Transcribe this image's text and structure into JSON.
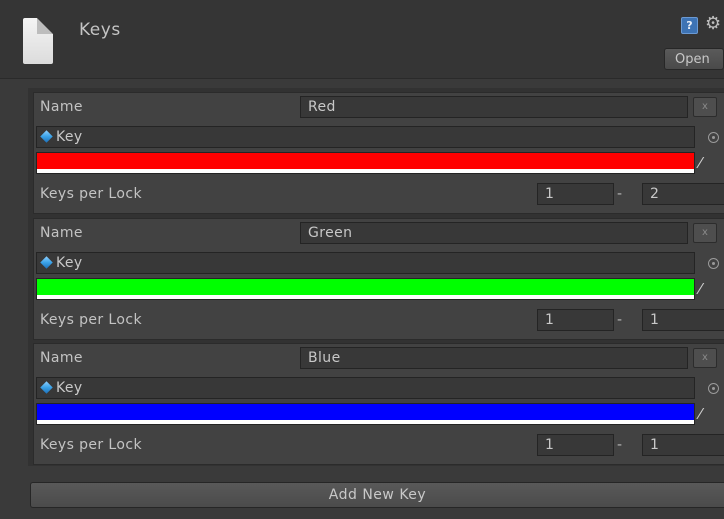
{
  "header": {
    "title": "Keys",
    "open_label": "Open",
    "help_icon": "help-icon",
    "gear_icon": "gear-icon"
  },
  "keys": [
    {
      "name_label": "Name",
      "name_value": "Red",
      "remove_label": "x",
      "object_label": "Key",
      "color": "#ff0000",
      "keys_per_lock_label": "Keys per Lock",
      "min": "1",
      "dash": "-",
      "max": "2"
    },
    {
      "name_label": "Name",
      "name_value": "Green",
      "remove_label": "x",
      "object_label": "Key",
      "color": "#00ff00",
      "keys_per_lock_label": "Keys per Lock",
      "min": "1",
      "dash": "-",
      "max": "1"
    },
    {
      "name_label": "Name",
      "name_value": "Blue",
      "remove_label": "x",
      "object_label": "Key",
      "color": "#0000ff",
      "keys_per_lock_label": "Keys per Lock",
      "min": "1",
      "dash": "-",
      "max": "1"
    }
  ],
  "footer": {
    "add_label": "Add New Key"
  }
}
